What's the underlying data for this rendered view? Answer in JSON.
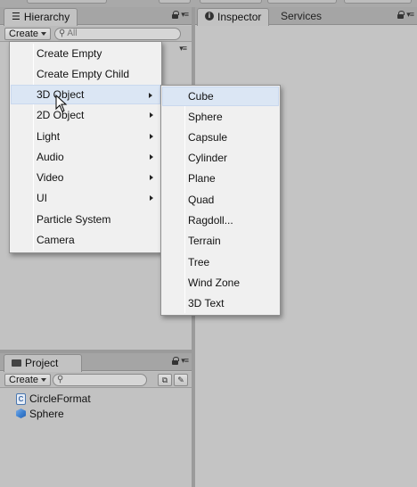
{
  "hierarchy": {
    "tab_label": "Hierarchy",
    "create_label": "Create",
    "search_placeholder": "All"
  },
  "inspector": {
    "tab_label": "Inspector",
    "services_label": "Services"
  },
  "create_menu": {
    "items": [
      {
        "label": "Create Empty",
        "has_submenu": false
      },
      {
        "label": "Create Empty Child",
        "has_submenu": false
      },
      {
        "label": "3D Object",
        "has_submenu": true,
        "highlighted": true
      },
      {
        "label": "2D Object",
        "has_submenu": true
      },
      {
        "label": "Light",
        "has_submenu": true
      },
      {
        "label": "Audio",
        "has_submenu": true
      },
      {
        "label": "Video",
        "has_submenu": true
      },
      {
        "label": "UI",
        "has_submenu": true
      },
      {
        "label": "Particle System",
        "has_submenu": false
      },
      {
        "label": "Camera",
        "has_submenu": false
      }
    ]
  },
  "submenu_3d_object": {
    "items": [
      {
        "label": "Cube",
        "highlighted": true
      },
      {
        "label": "Sphere"
      },
      {
        "label": "Capsule"
      },
      {
        "label": "Cylinder"
      },
      {
        "label": "Plane"
      },
      {
        "label": "Quad"
      },
      {
        "label": "Ragdoll..."
      },
      {
        "label": "Terrain"
      },
      {
        "label": "Tree"
      },
      {
        "label": "Wind Zone"
      },
      {
        "label": "3D Text"
      }
    ]
  },
  "project": {
    "tab_label": "Project",
    "create_label": "Create",
    "assets": [
      {
        "label": "CircleFormat",
        "icon": "csharp-script-icon"
      },
      {
        "label": "Sphere",
        "icon": "prefab-icon"
      }
    ]
  },
  "colors": {
    "panel_bg": "#c2c2c2",
    "menu_bg": "#f0f0f0",
    "menu_highlight": "#dbe6f4",
    "prefab_blue": "#3b7fd0"
  }
}
